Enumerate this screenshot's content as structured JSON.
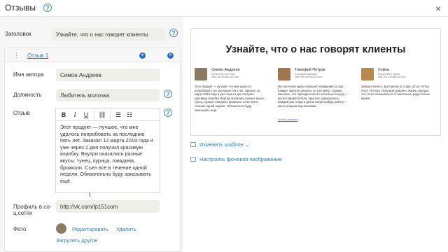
{
  "header": {
    "title": "Отзывы",
    "help": "?",
    "close": "×"
  },
  "form": {
    "heading_label": "Заголовок",
    "heading_value": "Узнайте, что о нас говорят клиенты",
    "review_tab": "Отзыв 1",
    "author_label": "Имя автора",
    "author_value": "Симон Андреев",
    "position_label": "Должность",
    "position_value": "Любитель молочка",
    "review_label": "Отзыв",
    "review_text": "Этот продукт — лучшее, что мне удалось попробовать за последние пять лет. Заказал 12 марта 2019 года и уже через 2 дня получил красивую коробку. Внутри оказались разные вкусы: тунец, курица, говядина, брокколи. Съел всё в течение одной недели. Обязательно буду заказывать ещё.",
    "toolbar": {
      "bold": "B",
      "italic": "I",
      "underline": "U"
    },
    "profile_label": "Профиль в со-\nц.сетях",
    "profile_value": "http://vk.com/lp151com",
    "photo_label": "Фото",
    "edit_label": "Редактировать",
    "delete_label": "Удалить",
    "upload_label": "Загрузить другое"
  },
  "preview": {
    "title": "Узнайте, что о нас говорят клиенты",
    "reviews": [
      {
        "name": "Симон Андреев",
        "role": "Любитель молочка",
        "profile": "http://vk.com/lp151com",
        "text": "Этот продукт — лучшее, что мне удалось попробовать за последние пять лет. Заказал 12 марта 2019 года и уже через 2 дня получил красивую коробку. Внутри оказались разные вкусы: тунец, курица, говядина, брокколи. Съел всё в течение одной недели. Обязательно буду заказывать ещё.",
        "photo_color": "#8a7a60"
      },
      {
        "name": "Тимофей Петров",
        "role": "Хороший мальчик",
        "profile": "http://vk.com/lp151com",
        "text": "Мы посетили курсы хорошего поведения 12 раз. Каждое занятие длилось по 120 минут. Однако, казалось, что проходило всего несколько секунд — мы всё время бегали, прыгали, кувыркались. Каждый раз, когда я делал какую-нибудь работу — меня угощали вкусняшками.",
        "more": "Читать целиком",
        "photo_color": "#a0764a"
      },
      {
        "name": "Хомка",
        "role": "Королева в норке",
        "profile": "http://vk.com/lp151com",
        "text": "Заказал колесо. Доставили за 3 дня. 22 шт. Устал. Поел. Поспал. Покупкой доволен. Жизнь хороша, что стоит отказываться от маленьких радостей на время.",
        "photo_color": "#b8894d"
      }
    ]
  },
  "actions": {
    "change_template": "Изменить шаблон",
    "background": "Настроить фоновое изображение"
  }
}
